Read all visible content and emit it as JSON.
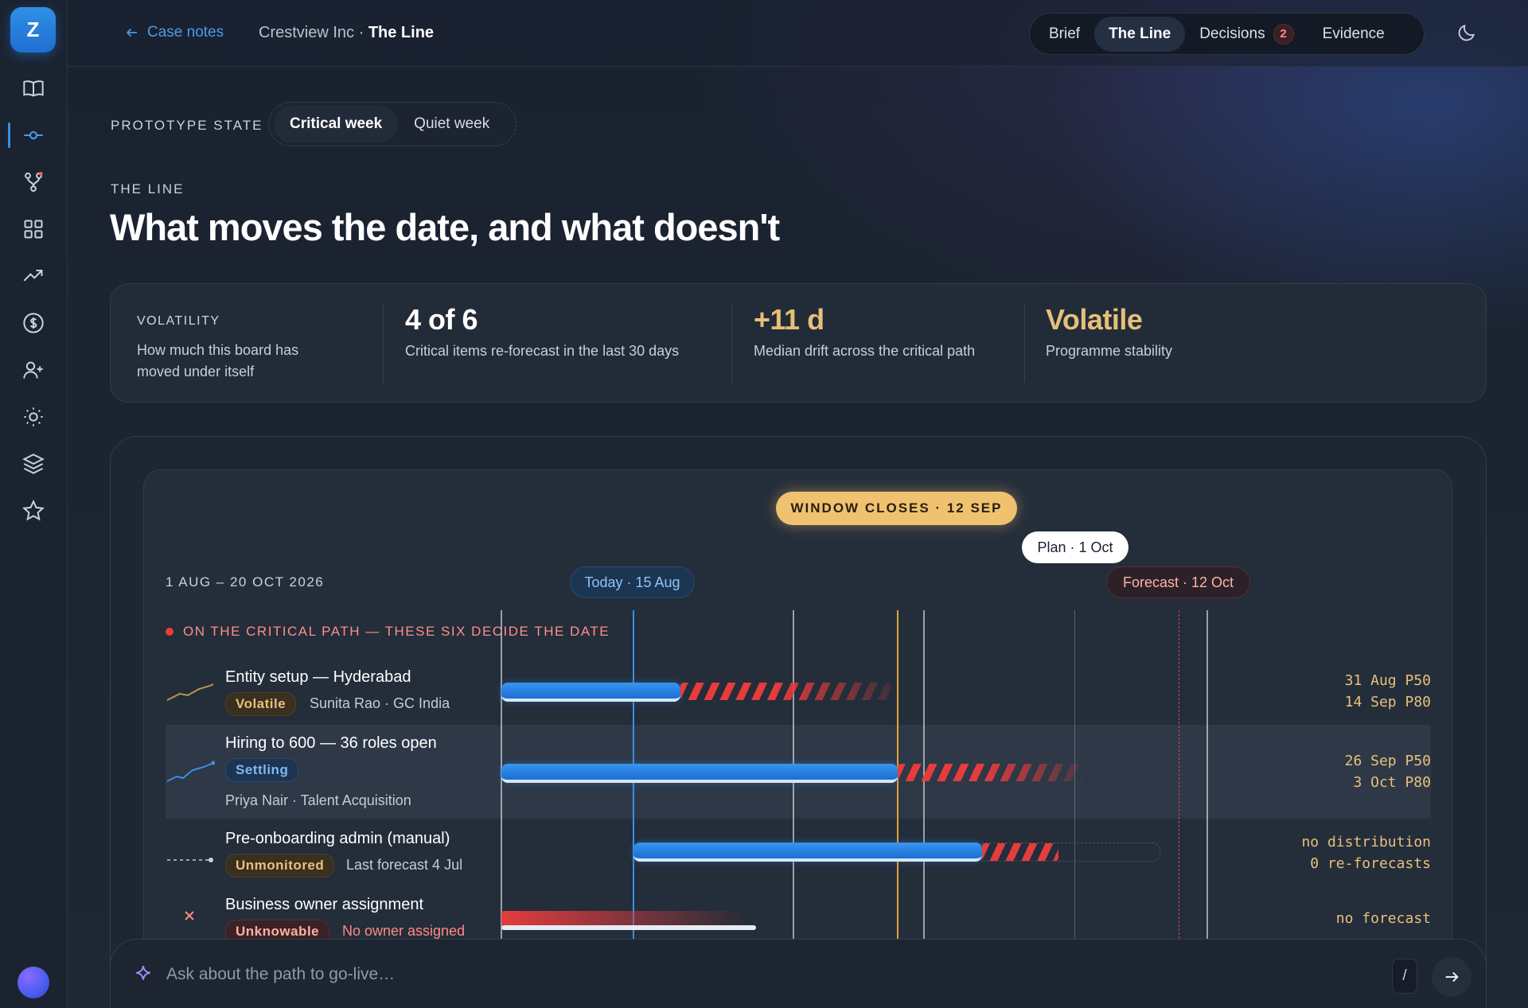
{
  "sidebar": {
    "logo": "Z",
    "items": [
      {
        "icon": "book-icon"
      },
      {
        "icon": "timeline-icon",
        "active": true
      },
      {
        "icon": "branch-icon"
      },
      {
        "icon": "grid-icon"
      },
      {
        "icon": "trending-up-icon"
      },
      {
        "icon": "dollar-icon"
      },
      {
        "icon": "add-user-icon"
      },
      {
        "icon": "sun-icon"
      },
      {
        "icon": "layers-icon"
      },
      {
        "icon": "star-icon"
      }
    ]
  },
  "topbar": {
    "back_label": "Case notes",
    "crumb_company": "Crestview Inc · ",
    "crumb_page": "The Line",
    "tabs": [
      {
        "label": "Brief"
      },
      {
        "label": "The Line",
        "active": true
      },
      {
        "label": "Decisions",
        "count": "2"
      },
      {
        "label": "Evidence"
      }
    ]
  },
  "prototype": {
    "label": "PROTOTYPE STATE",
    "options": [
      "Critical week",
      "Quiet week"
    ],
    "selected": "Critical week"
  },
  "header": {
    "eyebrow": "THE LINE",
    "title": "What moves the date, and what doesn't"
  },
  "volatility": {
    "caption": "VOLATILITY",
    "description": "How much this board has moved under itself",
    "stats": [
      {
        "value": "4 of 6",
        "label": "Critical items re-forecast in the last 30 days"
      },
      {
        "value": "+11 d",
        "label": "Median drift across the critical path"
      },
      {
        "value": "Volatile",
        "label": "Programme stability"
      }
    ]
  },
  "timeline": {
    "window": "WINDOW CLOSES · 12 SEP",
    "plan": "Plan · 1 Oct",
    "today": "Today · 15 Aug",
    "forecast": "Forecast · 12 Oct",
    "range": "1 AUG – 20 OCT 2026",
    "critical_label": "ON THE CRITICAL PATH — THESE SIX DECIDE THE DATE",
    "rows": [
      {
        "title": "Entity setup — Hyderabad",
        "tag": "Volatile",
        "owner": "Sunita Rao · GC India",
        "meta1": "31 Aug P50",
        "meta2": "14 Sep P80"
      },
      {
        "title": "Hiring to 600 — 36 roles open",
        "tag": "Settling",
        "owner": "Priya Nair · Talent Acquisition",
        "meta1": "26 Sep P50",
        "meta2": "3 Oct P80"
      },
      {
        "title": "Pre-onboarding admin (manual)",
        "tag": "Unmonitored",
        "owner": "Last forecast 4 Jul",
        "meta1": "no distribution",
        "meta2": "0 re-forecasts"
      },
      {
        "title": "Business owner assignment",
        "tag": "Unknowable",
        "owner": "No owner assigned",
        "meta1": "no forecast"
      }
    ]
  },
  "ask": {
    "placeholder": "Ask about the path to go-live…",
    "shortcut": "/"
  },
  "colors": {
    "accent": "#3a8fe8",
    "warning": "#f0c270",
    "critical": "#e53c3c"
  }
}
